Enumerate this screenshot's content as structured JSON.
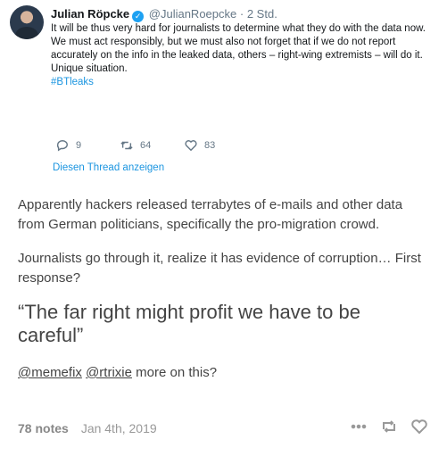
{
  "tweet": {
    "name": "Julian Röpcke",
    "handle": "@JulianRoepcke",
    "separator": "·",
    "time": "2 Std.",
    "lines": [
      "It will be thus very hard for journalists to determine what they do with the data now.",
      "We must act responsibly, but we must also not forget that if we do not report accurately on the info in the leaked data, others – right-wing extremists – will do it.",
      "Unique situation."
    ],
    "hashtag": "#BTleaks",
    "replies": "9",
    "retweets": "64",
    "likes": "83",
    "thread_link": "Diesen Thread anzeigen"
  },
  "post": {
    "para1": "Apparently hackers released terrabytes of e-mails and other data from German politicians, specifically the pro-migration crowd.",
    "para2": "Journalists go through it, realize it has evidence of corruption… First response?",
    "quote": "“The far right might profit we have to be careful”",
    "mention1": "@memefix",
    "mention2": "@rtrixie",
    "question": " more on this?"
  },
  "footer": {
    "notes": "78 notes",
    "date": "Jan 4th, 2019"
  },
  "colors": {
    "link": "#1b95e0",
    "text": "#444444",
    "muted": "#999999"
  }
}
